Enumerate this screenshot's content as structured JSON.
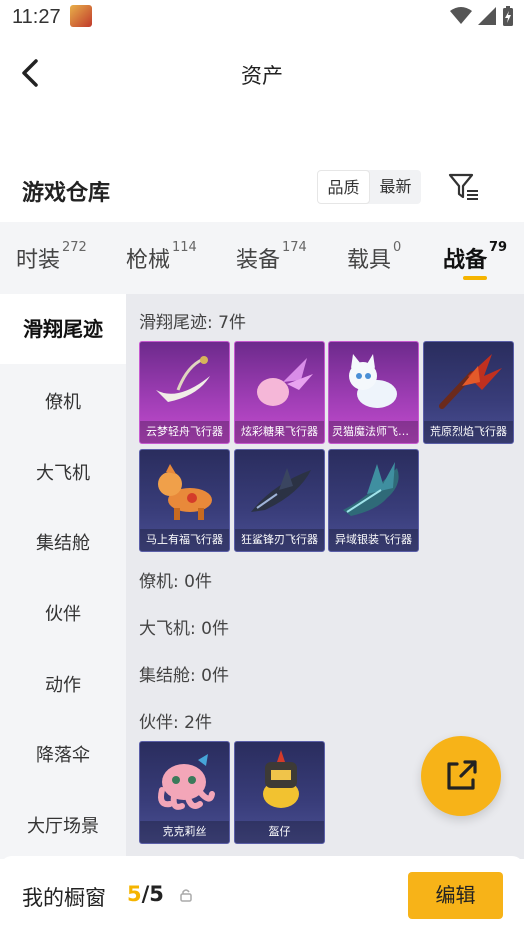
{
  "status_bar": {
    "time": "11:27",
    "app_icon_text": "和平精英"
  },
  "header": {
    "title": "资产"
  },
  "warehouse": {
    "title": "游戏仓库",
    "sort_options": [
      "品质",
      "最新"
    ]
  },
  "tabs": [
    {
      "label": "时装",
      "count": "272"
    },
    {
      "label": "枪械",
      "count": "114"
    },
    {
      "label": "装备",
      "count": "174"
    },
    {
      "label": "载具",
      "count": "0"
    },
    {
      "label": "战备",
      "count": "79"
    }
  ],
  "sidebar": [
    "滑翔尾迹",
    "僚机",
    "大飞机",
    "集结舱",
    "伙伴",
    "动作",
    "降落伞",
    "大厅场景"
  ],
  "sections": {
    "trail": {
      "title": "滑翔尾迹: 7件"
    },
    "wingman": {
      "title": "僚机: 0件"
    },
    "plane": {
      "title": "大飞机: 0件"
    },
    "pod": {
      "title": "集结舱: 0件"
    },
    "partner": {
      "title": "伙伴: 2件"
    }
  },
  "trail_items": [
    {
      "name": "云梦轻舟飞行器",
      "icon": "boat-icon",
      "tier": "purple"
    },
    {
      "name": "炫彩糖果飞行器",
      "icon": "candy-icon",
      "tier": "purple"
    },
    {
      "name": "灵猫魔法师飞行器",
      "icon": "cat-icon",
      "tier": "purple"
    },
    {
      "name": "荒原烈焰飞行器",
      "icon": "flame-wing-icon",
      "tier": "blue"
    },
    {
      "name": "马上有福飞行器",
      "icon": "horse-icon",
      "tier": "blue"
    },
    {
      "name": "狂鲨锋刃飞行器",
      "icon": "shark-icon",
      "tier": "blue"
    },
    {
      "name": "异域银装飞行器",
      "icon": "dragon-icon",
      "tier": "blue"
    }
  ],
  "partner_items": [
    {
      "name": "克克莉丝",
      "icon": "octopus-icon",
      "tier": "blue"
    },
    {
      "name": "盔仔",
      "icon": "chick-icon",
      "tier": "blue"
    }
  ],
  "showcase": {
    "label": "我的橱窗",
    "count": "5",
    "total": "/5",
    "edit_label": "编辑"
  },
  "colors": {
    "accent": "#F7B318",
    "purple_tier": "#9E3DB4",
    "blue_tier": "#393D7A"
  }
}
